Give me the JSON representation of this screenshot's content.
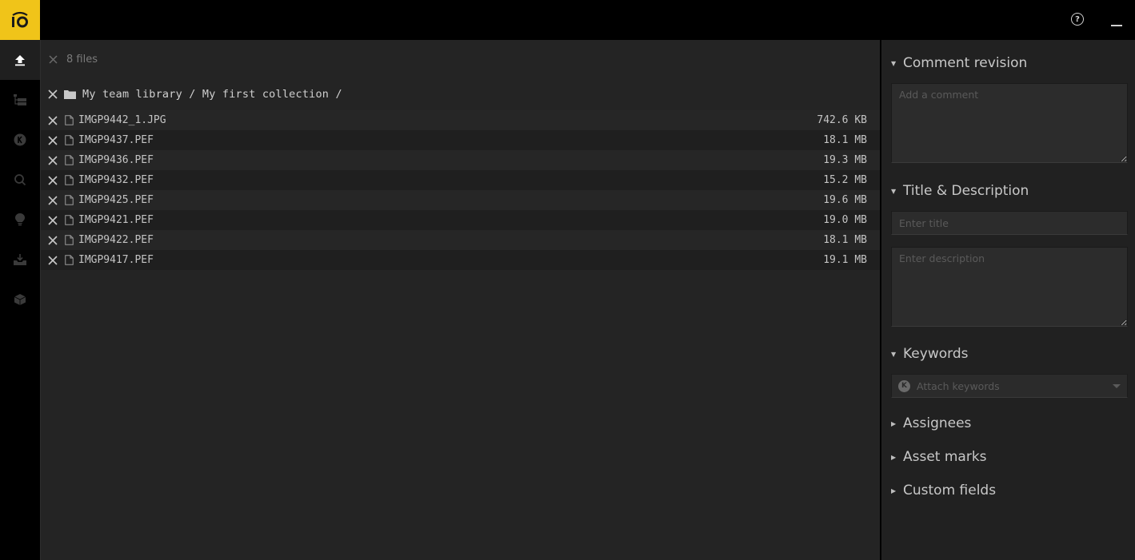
{
  "app": {
    "logo_text": "iO",
    "brand_color": "#f0c419"
  },
  "topbar": {
    "help_icon": "question-circle-icon",
    "help_glyph": "?",
    "minimize_icon": "minimize-icon"
  },
  "leftnav": {
    "items": [
      {
        "name": "upload",
        "icon": "upload-icon",
        "active": true
      },
      {
        "name": "hierarchy",
        "icon": "folder-tree-icon",
        "active": false
      },
      {
        "name": "keywords",
        "icon": "keyword-k-icon",
        "active": false
      },
      {
        "name": "search",
        "icon": "search-icon",
        "active": false
      },
      {
        "name": "ideas",
        "icon": "lightbulb-icon",
        "active": false
      },
      {
        "name": "inbox",
        "icon": "inbox-download-icon",
        "active": false
      },
      {
        "name": "packages",
        "icon": "box-icon",
        "active": false
      }
    ]
  },
  "main": {
    "files_count": "8 files",
    "folder_path": "My team library / My first collection /",
    "files": [
      {
        "name": "IMGP9442_1.JPG",
        "size": "742.6 KB"
      },
      {
        "name": "IMGP9437.PEF",
        "size": "18.1 MB"
      },
      {
        "name": "IMGP9436.PEF",
        "size": "19.3 MB"
      },
      {
        "name": "IMGP9432.PEF",
        "size": "15.2 MB"
      },
      {
        "name": "IMGP9425.PEF",
        "size": "19.6 MB"
      },
      {
        "name": "IMGP9421.PEF",
        "size": "19.0 MB"
      },
      {
        "name": "IMGP9422.PEF",
        "size": "18.1 MB"
      },
      {
        "name": "IMGP9417.PEF",
        "size": "19.1 MB"
      }
    ]
  },
  "rightpanel": {
    "comment": {
      "title": "Comment revision",
      "expanded": true,
      "placeholder": "Add a comment",
      "value": ""
    },
    "title_desc": {
      "title": "Title & Description",
      "expanded": true,
      "title_placeholder": "Enter title",
      "title_value": "",
      "description_placeholder": "Enter description",
      "description_value": ""
    },
    "keywords": {
      "title": "Keywords",
      "expanded": true,
      "badge": "K",
      "placeholder": "Attach keywords"
    },
    "assignees": {
      "title": "Assignees",
      "expanded": false
    },
    "asset_marks": {
      "title": "Asset marks",
      "expanded": false
    },
    "custom_fields": {
      "title": "Custom fields",
      "expanded": false
    }
  },
  "carets": {
    "expanded": "▼",
    "collapsed": "▶"
  }
}
